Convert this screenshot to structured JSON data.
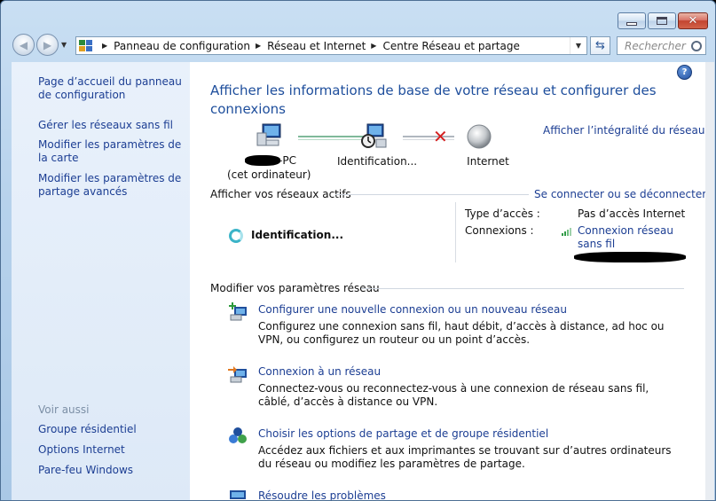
{
  "window": {
    "caption_buttons": [
      "minimize",
      "maximize",
      "close"
    ]
  },
  "navigation": {
    "breadcrumbs": [
      "Panneau de configuration",
      "Réseau et Internet",
      "Centre Réseau et partage"
    ],
    "search_placeholder": "Rechercher"
  },
  "sidebar": {
    "tasks": [
      "Page d’accueil du panneau de configuration",
      "Gérer les réseaux sans fil",
      "Modifier les paramètres de la carte",
      "Modifier les paramètres de partage avancés"
    ],
    "see_also_heading": "Voir aussi",
    "see_also": [
      "Groupe résidentiel",
      "Options Internet",
      "Pare-feu Windows"
    ]
  },
  "main": {
    "title": "Afficher les informations de base de votre réseau et configurer des connexions",
    "full_map_link": "Afficher l’intégralité du réseau",
    "network_map": {
      "computer_name_suffix": "-PC",
      "computer_caption": "(cet ordinateur)",
      "network": "Identification...",
      "internet": "Internet"
    },
    "active_networks": {
      "heading": "Afficher vos réseaux actifs",
      "connect_link": "Se connecter ou se déconnecter",
      "network_status": "Identification...",
      "access_type_label": "Type d’accès :",
      "access_type_value": "Pas d’accès Internet",
      "connections_label": "Connexions :",
      "connection_name": "Connexion réseau sans fil"
    },
    "change_settings": {
      "heading": "Modifier vos paramètres réseau",
      "actions": [
        {
          "title": "Configurer une nouvelle connexion ou un nouveau réseau",
          "description": "Configurez une connexion sans fil, haut débit, d’accès à distance, ad hoc ou VPN, ou configurez un routeur ou un point d’accès."
        },
        {
          "title": "Connexion à un réseau",
          "description": "Connectez-vous ou reconnectez-vous à une connexion de réseau sans fil, câblé, d’accès à distance ou VPN."
        },
        {
          "title": "Choisir les options de partage et de groupe résidentiel",
          "description": "Accédez aux fichiers et aux imprimantes se trouvant sur d’autres ordinateurs du réseau ou modifiez les paramètres de partage."
        },
        {
          "title": "Résoudre les problèmes",
          "description": ""
        }
      ]
    }
  },
  "colors": {
    "link": "#1c3e93",
    "title": "#1e4e9c",
    "sidebar_bg": "#e4eef9",
    "frame": "#b7d2ec"
  }
}
